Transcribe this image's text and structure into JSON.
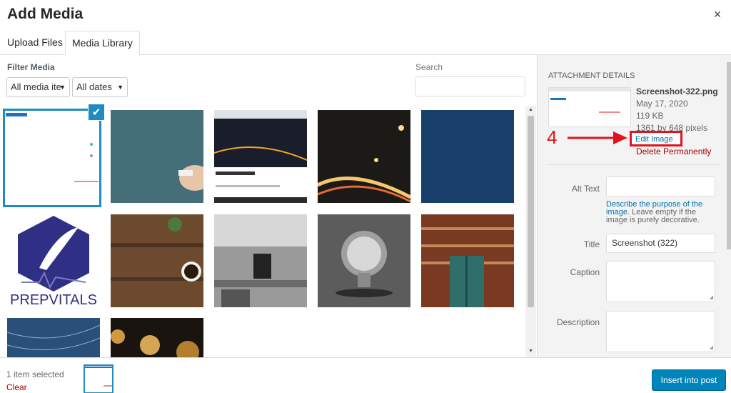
{
  "modal": {
    "title": "Add Media",
    "close_glyph": "×"
  },
  "tabs": [
    {
      "label": "Upload Files"
    },
    {
      "label": "Media Library"
    }
  ],
  "filter": {
    "label": "Filter Media",
    "type_selected": "All media ite",
    "date_selected": "All dates",
    "arrow_glyph": "▼"
  },
  "search": {
    "label": "Search",
    "value": ""
  },
  "grid": {
    "items": [
      {
        "name": "Screenshot (322)",
        "selected": true
      },
      {
        "name": "Chalkboard hand"
      },
      {
        "name": "Latest articles screenshot"
      },
      {
        "name": "Night highway"
      },
      {
        "name": "Blue texture"
      },
      {
        "name": "PrepVitals logo",
        "logo_text": "PREPVITALS"
      },
      {
        "name": "Desk with coffee"
      },
      {
        "name": "Office workspace"
      },
      {
        "name": "Light bulb"
      },
      {
        "name": "Bookshelf door"
      },
      {
        "name": "Star trails"
      },
      {
        "name": "Bulb lights"
      }
    ],
    "check_glyph": "✔"
  },
  "attachment": {
    "heading": "Attachment Details",
    "filename": "Screenshot-322.png",
    "date": "May 17, 2020",
    "size": "119 KB",
    "dimensions": "1361 by 648 pixels",
    "edit_label": "Edit Image",
    "delete_label": "Delete Permanently",
    "annotation_number": "4",
    "alt_label": "Alt Text",
    "alt_value": "",
    "alt_help_link": "Describe the purpose of the image",
    "alt_help_rest": ". Leave empty if the image is purely decorative.",
    "title_label": "Title",
    "title_value": "Screenshot (322)",
    "caption_label": "Caption",
    "caption_value": "",
    "description_label": "Description",
    "description_value": ""
  },
  "footer": {
    "selected_text": "1 item selected",
    "clear_label": "Clear",
    "insert_label": "Insert into post"
  },
  "colors": {
    "accent": "#0085ba",
    "selection": "#1e8cbe",
    "danger": "#a00",
    "annotation": "#e0141e"
  }
}
